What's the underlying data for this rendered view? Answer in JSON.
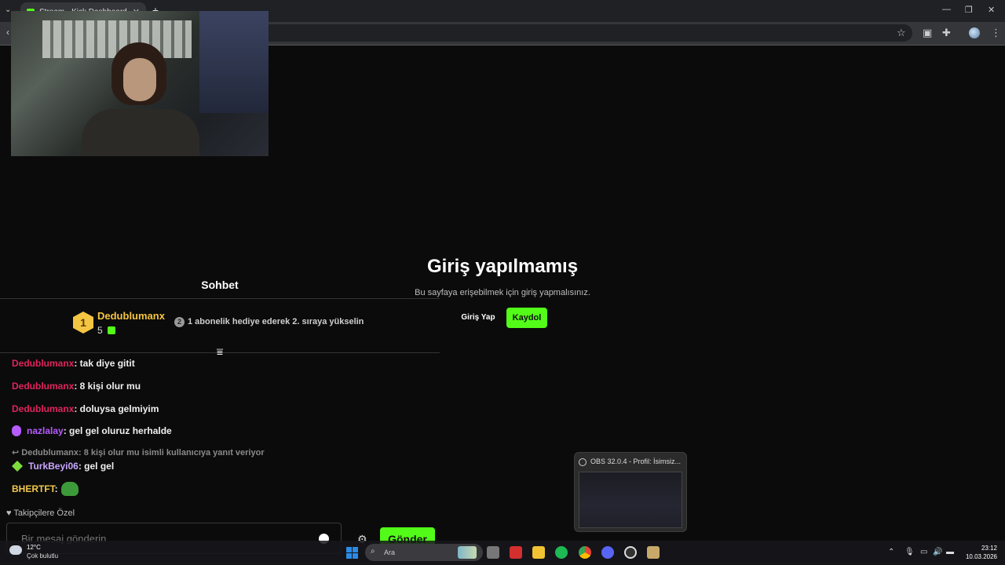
{
  "browser": {
    "tab_title": "Stream - Kick Dashboard",
    "tab_close": "✕",
    "new_tab": "+"
  },
  "login": {
    "title": "Giriş yapılmamış",
    "subtitle": "Bu sayfaya erişebilmek için giriş yapmalısınız.",
    "login_label": "Giriş Yap",
    "register_label": "Kaydol"
  },
  "chat": {
    "title": "Sohbet",
    "top_gifter": {
      "rank": "1",
      "name": "Dedublumanx",
      "count": "5",
      "info": "1 abonelik hediye ederek 2. sıraya yükselin",
      "info_rank": "2"
    },
    "messages": [
      {
        "user": "Dedublumanx",
        "text": ": tak diye gitit",
        "color": "#e0245e"
      },
      {
        "user": "Dedublumanx",
        "text": ": 8 kişi olur mu",
        "color": "#e0245e"
      },
      {
        "user": "Dedublumanx",
        "text": ": doluysa gelmiyim",
        "color": "#e0245e"
      },
      {
        "user": "nazlalay",
        "text": ": gel gel oluruz herhalde",
        "color": "#b65cff"
      },
      {
        "user": "TurkBeyi06",
        "text": ": gel gel",
        "color": "#c9a6ff"
      },
      {
        "user": "BHERTFT",
        "text": ":",
        "color": "#f2c94c"
      }
    ],
    "reply_note": "Dedublumanx: 8 kişi olur mu isimli kullanıcıya yanıt veriyor",
    "followers_only": "Takipçilere Özel",
    "input_placeholder": "Bir mesaj gönderin",
    "send_label": "Gönder"
  },
  "obs_preview": {
    "title": "OBS 32.0.4 - Profil: İsimsiz..."
  },
  "taskbar": {
    "weather_temp": "12°C",
    "weather_desc": "Çok bulutlu",
    "search_label": "Ara",
    "time": "23:12",
    "date": "10.03.2026"
  },
  "colors": {
    "accent": "#53fc18",
    "background": "#0b0b0b"
  }
}
